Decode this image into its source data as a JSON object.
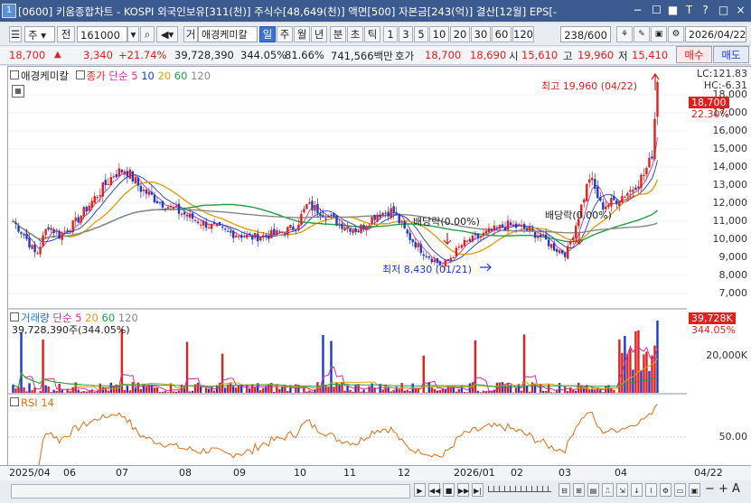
{
  "window": {
    "title": "[0600] 키움종합차트 - KOSPI 외국인보유[311(천)] 주식수[48,649(천)] 액면[500] 자본금[243(억)] 결산[12월] EPS[-",
    "app_icon": "1",
    "controls": [
      "−",
      "☐",
      "■",
      "T",
      "?",
      "□",
      "×"
    ]
  },
  "toolbar": {
    "type_select": "주",
    "range_button": "전",
    "code": "161000",
    "mode_badge": "거",
    "name": "애경케미칼",
    "periods": [
      "일",
      "주",
      "월",
      "년",
      "분",
      "초",
      "틱"
    ],
    "active_period": "일",
    "intervals": [
      "1",
      "3",
      "5",
      "10",
      "20",
      "30",
      "60",
      "120"
    ],
    "count": "238/600",
    "date": "2026/04/22"
  },
  "quote": {
    "price": "18,700",
    "change": "3,340",
    "change_pct": "+21.74%",
    "volume": "39,728,390",
    "volume_ratio": "344.05%",
    "turnover": "81.66%",
    "amount": "741,566백만",
    "bid_label": "호가",
    "ask": "18,700",
    "bid": "18,690",
    "open_label": "시",
    "open": "15,610",
    "high_label": "고",
    "high": "19,960",
    "low_label": "저",
    "low": "15,410",
    "buy_label": "매수",
    "sell_label": "매도"
  },
  "legend": {
    "name": "애경케미칼",
    "close": "종가",
    "ma_type": "단순",
    "ma": [
      "5",
      "10",
      "20",
      "60",
      "120"
    ],
    "ma_colors": [
      "#d0309a",
      "#1a3ad0",
      "#e0a010",
      "#20a040",
      "#888888"
    ]
  },
  "annotations": {
    "high": "최고 19,960 (04/22)",
    "low": "최저 8,430 (01/21)",
    "dividend1": "배당락(0.00%)",
    "dividend2": "배당락(0.00%)"
  },
  "price_axis": {
    "lc": "LC:121.83",
    "hc": "HC:-6.31",
    "current": "18,700",
    "current_pct": "22.30%",
    "ticks": [
      "18,000",
      "17,000",
      "16,000",
      "15,000",
      "14,000",
      "13,000",
      "12,000",
      "11,000",
      "10,000",
      "9,000",
      "8,000",
      "7,000"
    ]
  },
  "volume_panel": {
    "label": "거래량",
    "ma_type": "단순",
    "ma": [
      "5",
      "20",
      "60",
      "120"
    ],
    "value_text": "39,728,390주(344.05%)",
    "axis_current": "39,728K",
    "axis_pct": "344.05%",
    "axis_tick": "20,000K"
  },
  "rsi_panel": {
    "label": "RSI 14",
    "axis_tick": "50.00"
  },
  "xaxis": {
    "labels": [
      "2025/04",
      "06",
      "07",
      "08",
      "09",
      "10",
      "11",
      "12",
      "2026/01",
      "02",
      "03",
      "04"
    ],
    "right": "04/22"
  },
  "chart_data": [
    {
      "type": "line",
      "title": "",
      "series": [
        {
          "name": "종가",
          "values": []
        }
      ],
      "x": [
        "2025/04",
        "06",
        "07",
        "08",
        "09",
        "10",
        "11",
        "12",
        "2026/01",
        "02",
        "03",
        "04"
      ],
      "ylim": [
        6500,
        19960
      ]
    }
  ]
}
